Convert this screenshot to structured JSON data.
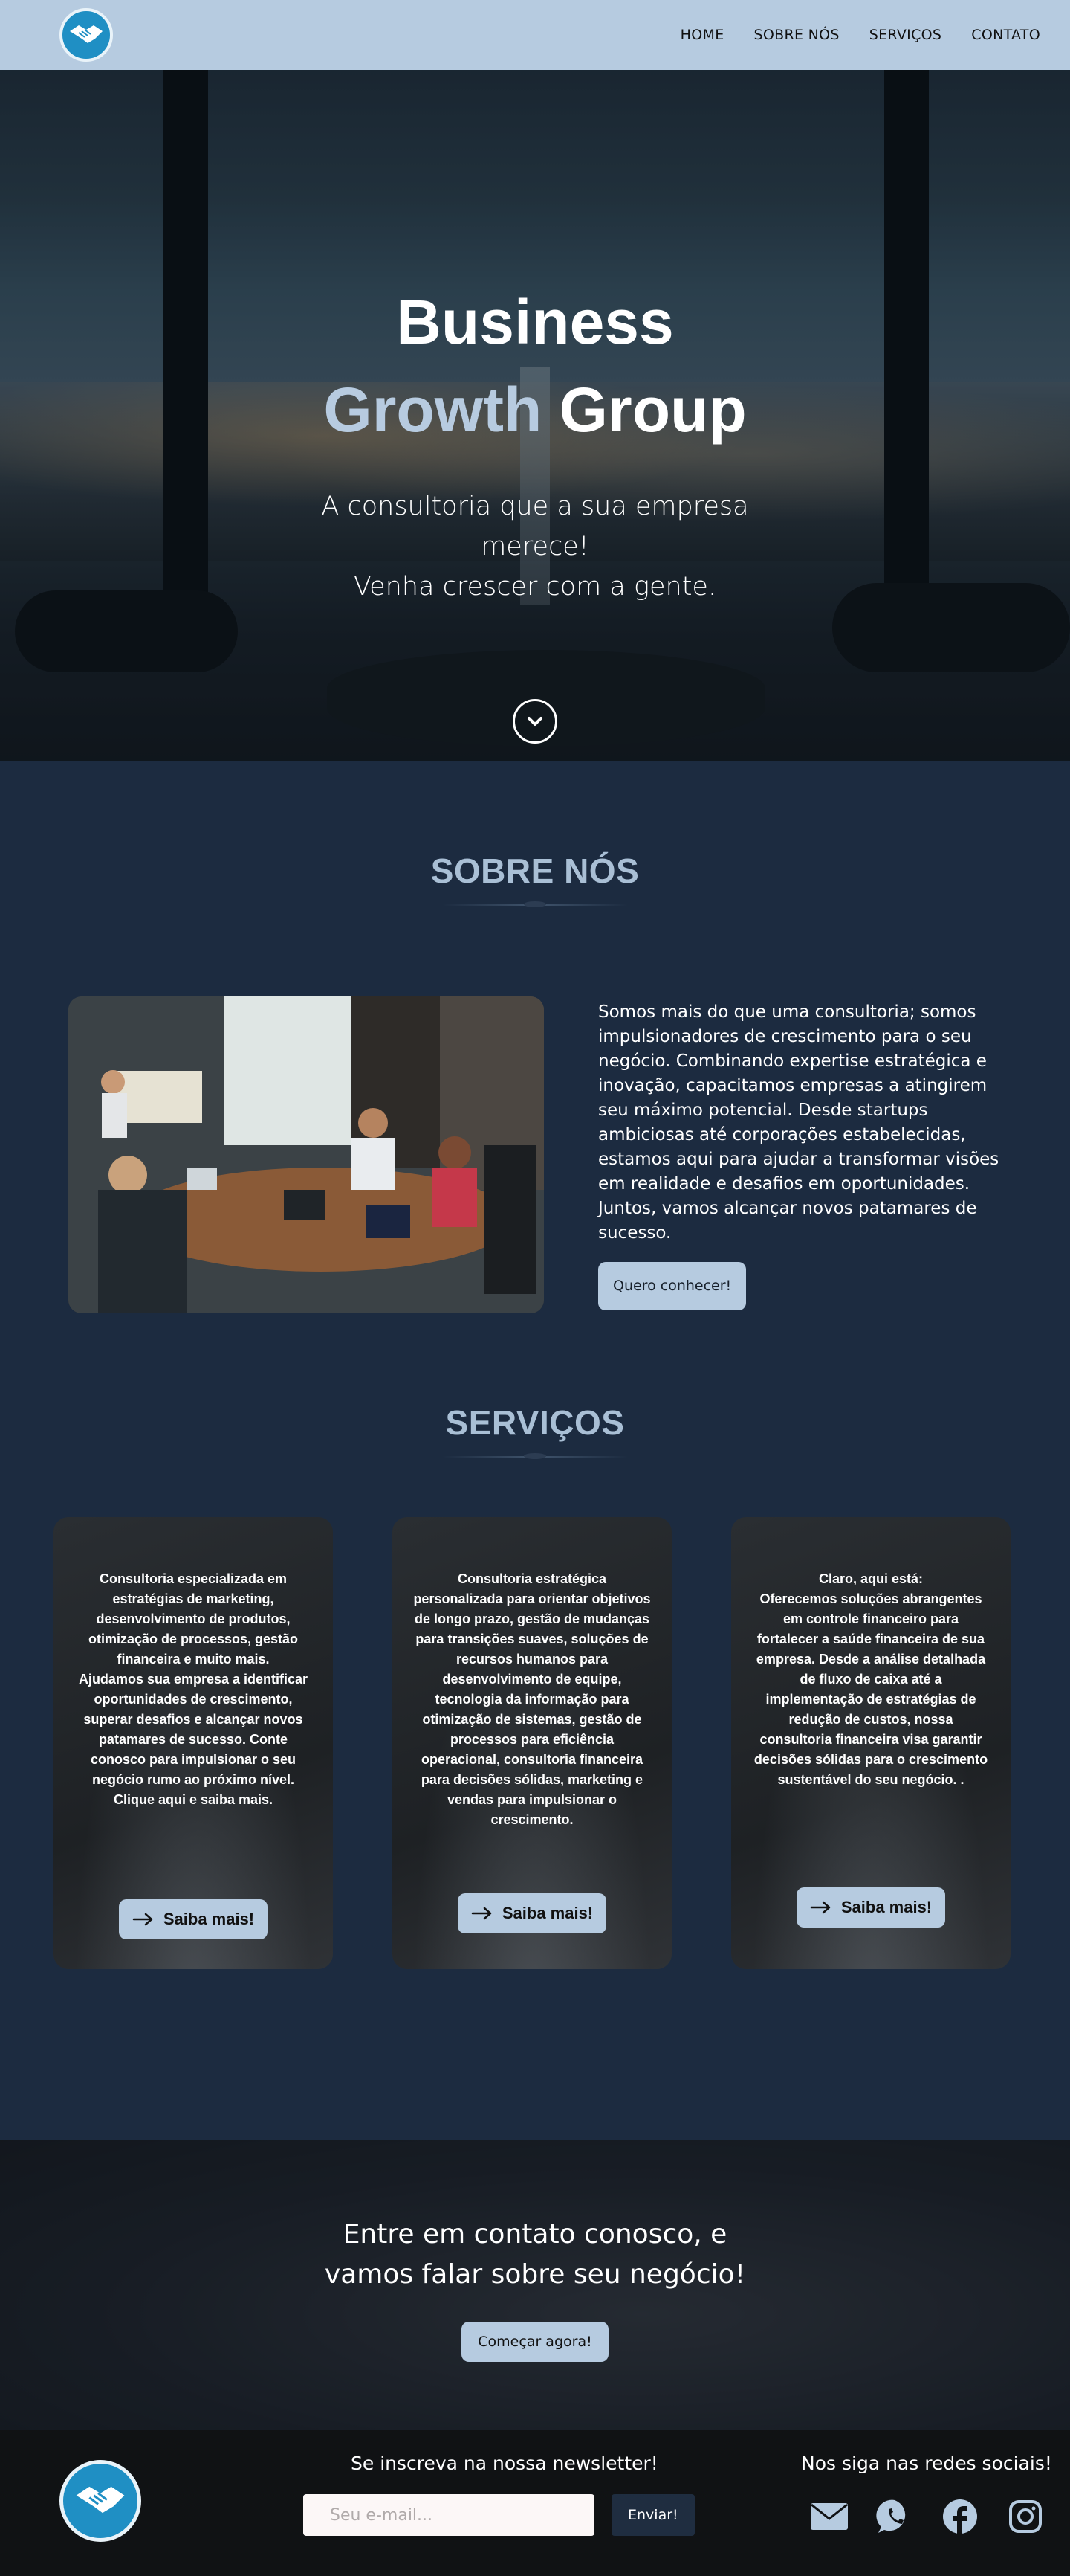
{
  "nav": {
    "logo_alt": "handshake-logo",
    "links": [
      "HOME",
      "SOBRE NÓS",
      "SERVIÇOS",
      "CONTATO"
    ]
  },
  "hero": {
    "title_line1": "Business",
    "title_accent": "Growth",
    "title_word": "Group",
    "subtitle_line1": "A consultoria que a sua empresa",
    "subtitle_line2": "merece!",
    "subtitle_line3": "Venha crescer com a gente."
  },
  "sobre": {
    "title": "SOBRE NÓS",
    "text": "Somos mais do que uma consultoria; somos impulsionadores de crescimento para o seu negócio. Combinando expertise estratégica e inovação, capacitamos empresas a atingirem seu máximo potencial. Desde startups ambiciosas até corporações estabelecidas, estamos aqui para ajudar a transformar visões em realidade e desafios em oportunidades. Juntos, vamos alcançar novos patamares de sucesso.",
    "button": "Quero conhecer!"
  },
  "servicos": {
    "title": "SERVIÇOS",
    "cards": [
      {
        "text": "Consultoria especializada em estratégias de marketing, desenvolvimento de produtos, otimização de processos, gestão financeira e muito mais.\nAjudamos sua empresa a identificar oportunidades de crescimento, superar desafios e alcançar novos patamares de sucesso. Conte conosco para impulsionar o seu negócio rumo ao próximo nível.\nClique aqui e saiba mais.",
        "button": "Saiba mais!"
      },
      {
        "text": "Consultoria estratégica personalizada para orientar objetivos de longo prazo, gestão de mudanças para transições suaves, soluções de recursos humanos para desenvolvimento de equipe, tecnologia da informação para otimização de sistemas, gestão de processos para eficiência operacional, consultoria financeira para decisões sólidas, marketing e vendas para impulsionar o crescimento.",
        "button": "Saiba mais!"
      },
      {
        "text": "Claro, aqui está:\nOferecemos soluções abrangentes em controle financeiro para fortalecer a saúde financeira de sua empresa. Desde a análise detalhada de fluxo de caixa até a implementação de estratégias de redução de custos, nossa consultoria financeira visa garantir decisões sólidas para o crescimento sustentável do seu negócio. .",
        "button": "Saiba mais!"
      }
    ]
  },
  "contato": {
    "title_line1": "Entre em contato conosco, e",
    "title_line2": "vamos falar sobre seu negócio!",
    "button": "Começar agora!"
  },
  "footer": {
    "newsletter_title": "Se inscreva na nossa newsletter!",
    "email_placeholder": "Seu e-mail...",
    "submit": "Enviar!",
    "social_title": "Nos siga nas redes sociais!",
    "social_icons": [
      "mail-icon",
      "whatsapp-icon",
      "facebook-icon",
      "instagram-icon"
    ]
  },
  "colors": {
    "nav_bg": "#b6cbe0",
    "page_bg": "#1c2b40",
    "accent": "#b7cbe0",
    "title": "#a9bfd5",
    "footer_bg": "#101214",
    "logo_blue": "#1f8fc4"
  }
}
